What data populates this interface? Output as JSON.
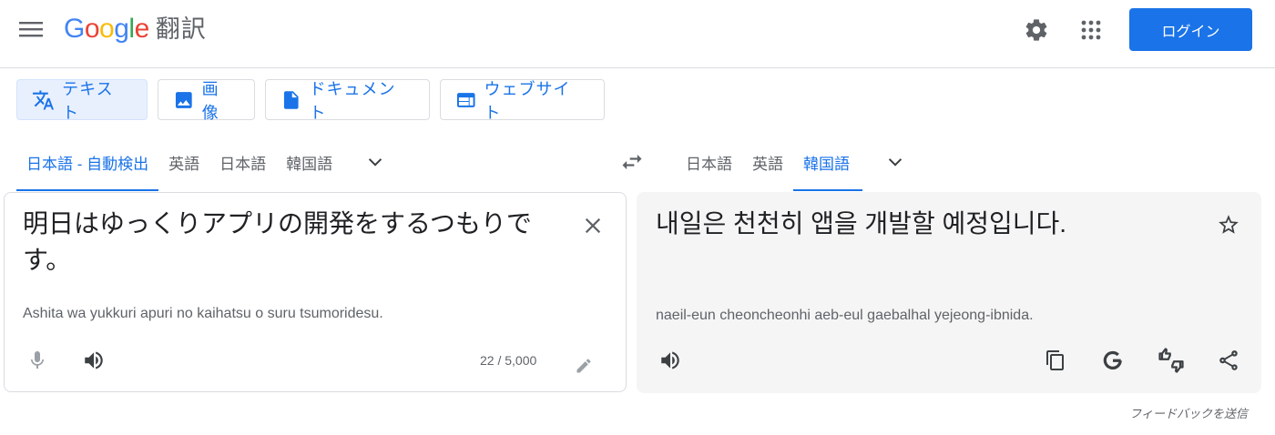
{
  "header": {
    "logo_google": [
      "G",
      "o",
      "o",
      "g",
      "l",
      "e"
    ],
    "product_name": "翻訳",
    "login_label": "ログイン"
  },
  "icons": {
    "menu": "hamburger-menu-icon",
    "settings": "gear-icon",
    "apps": "apps-grid-icon"
  },
  "modes": [
    {
      "label": "テキスト",
      "icon": "translate-icon",
      "active": true
    },
    {
      "label": "画像",
      "icon": "image-icon",
      "active": false
    },
    {
      "label": "ドキュメント",
      "icon": "document-icon",
      "active": false
    },
    {
      "label": "ウェブサイト",
      "icon": "website-icon",
      "active": false
    }
  ],
  "source_languages": [
    {
      "label": "日本語 - 自動検出",
      "active": true
    },
    {
      "label": "英語",
      "active": false
    },
    {
      "label": "日本語",
      "active": false
    },
    {
      "label": "韓国語",
      "active": false
    }
  ],
  "target_languages": [
    {
      "label": "日本語",
      "active": false
    },
    {
      "label": "英語",
      "active": false
    },
    {
      "label": "韓国語",
      "active": true
    }
  ],
  "source": {
    "text": "明日はゆっくりアプリの開発をするつもりです。",
    "romanization": "Ashita wa yukkuri apuri no kaihatsu o suru tsumoridesu.",
    "char_count": "22 / 5,000"
  },
  "target": {
    "text": "내일은 천천히 앱을 개발할 예정입니다.",
    "romanization": "naeil-eun cheoncheonhi aeb-eul gaebalhal yejeong-ibnida."
  },
  "footer": {
    "feedback": "フィードバックを送信"
  },
  "colors": {
    "accent": "#1a73e8",
    "active_tab_bg": "#e8f0fe",
    "target_panel_bg": "#f5f5f5"
  }
}
